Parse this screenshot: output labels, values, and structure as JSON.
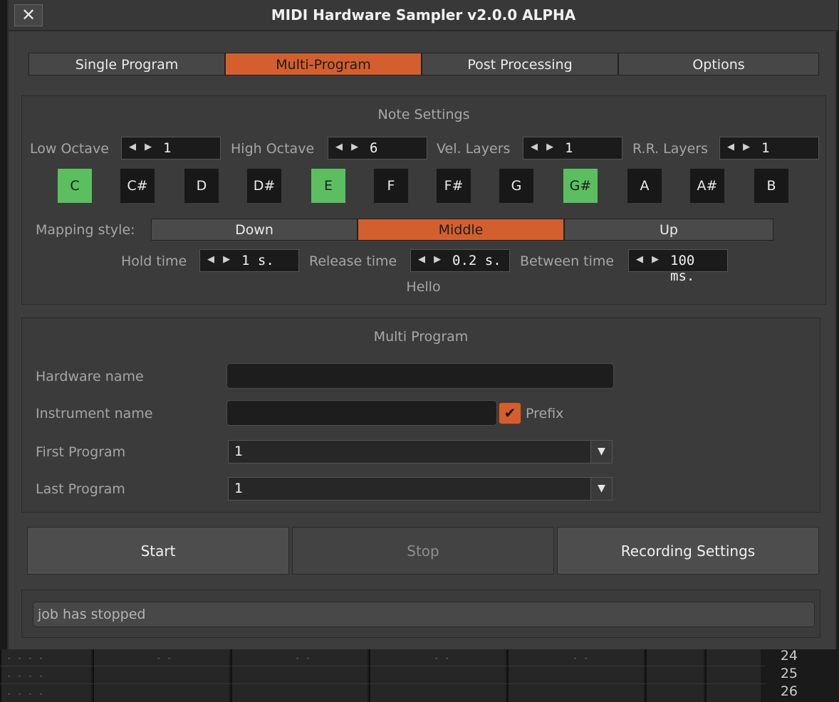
{
  "window": {
    "title": "MIDI Hardware Sampler v2.0.0 ALPHA",
    "close_glyph": "✕"
  },
  "tabs": [
    {
      "label": "Single Program",
      "active": false
    },
    {
      "label": "Multi-Program",
      "active": true
    },
    {
      "label": "Post Processing",
      "active": false
    },
    {
      "label": "Options",
      "active": false
    }
  ],
  "note_settings": {
    "title": "Note Settings",
    "low_octave": {
      "label": "Low Octave",
      "value": "1"
    },
    "high_octave": {
      "label": "High Octave",
      "value": "6"
    },
    "vel_layers": {
      "label": "Vel. Layers",
      "value": "1"
    },
    "rr_layers": {
      "label": "R.R. Layers",
      "value": "1"
    },
    "keys": [
      {
        "label": "C",
        "on": true
      },
      {
        "label": "C#",
        "on": false
      },
      {
        "label": "D",
        "on": false
      },
      {
        "label": "D#",
        "on": false
      },
      {
        "label": "E",
        "on": true
      },
      {
        "label": "F",
        "on": false
      },
      {
        "label": "F#",
        "on": false
      },
      {
        "label": "G",
        "on": false
      },
      {
        "label": "G#",
        "on": true
      },
      {
        "label": "A",
        "on": false
      },
      {
        "label": "A#",
        "on": false
      },
      {
        "label": "B",
        "on": false
      }
    ],
    "mapping_label": "Mapping style:",
    "mapping": [
      {
        "label": "Down",
        "active": false
      },
      {
        "label": "Middle",
        "active": true
      },
      {
        "label": "Up",
        "active": false
      }
    ],
    "hold_time": {
      "label": "Hold time",
      "value": "1 s."
    },
    "release_time": {
      "label": "Release time",
      "value": "0.2 s."
    },
    "between_time": {
      "label": "Between time",
      "value": "100 ms."
    },
    "hint": "Hello"
  },
  "multi_program": {
    "title": "Multi Program",
    "hardware_name": {
      "label": "Hardware name",
      "value": ""
    },
    "instrument_name": {
      "label": "Instrument name",
      "value": ""
    },
    "prefix": {
      "label": "Prefix",
      "checked": true
    },
    "first_program": {
      "label": "First Program",
      "value": "1"
    },
    "last_program": {
      "label": "Last Program",
      "value": "1"
    }
  },
  "actions": {
    "start": "Start",
    "stop": "Stop",
    "recording_settings": "Recording Settings"
  },
  "status": "job has stopped",
  "background": {
    "row_numbers": [
      "24",
      "25",
      "26"
    ]
  },
  "icons": {
    "spin_arrows": "◀ ▶",
    "dropdown": "▼",
    "check": "✔"
  },
  "colors": {
    "accent": "#d45f2e",
    "key_on": "#5cbf5f"
  }
}
